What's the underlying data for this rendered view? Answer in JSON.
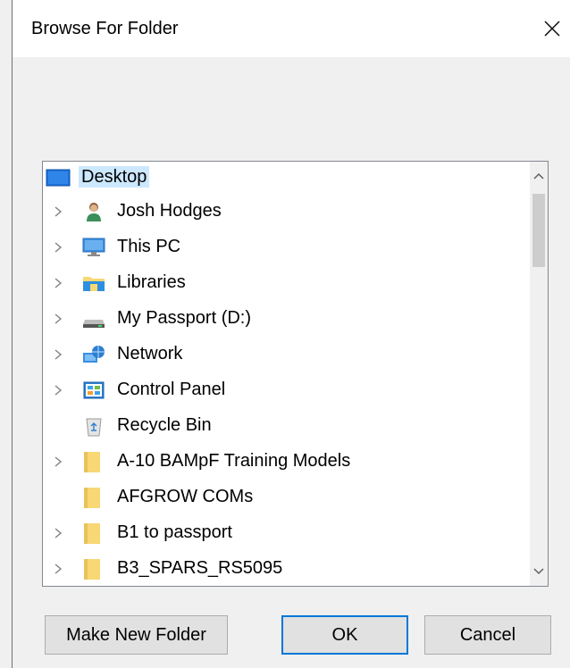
{
  "window": {
    "title": "Browse For Folder",
    "close_icon": "close-icon"
  },
  "tree": {
    "items": [
      {
        "label": "Desktop",
        "icon": "desktop-icon",
        "expandable": false,
        "selected": true,
        "level": 0
      },
      {
        "label": "Josh Hodges",
        "icon": "user-icon",
        "expandable": true,
        "selected": false,
        "level": 1
      },
      {
        "label": "This PC",
        "icon": "computer-icon",
        "expandable": true,
        "selected": false,
        "level": 1
      },
      {
        "label": "Libraries",
        "icon": "libraries-icon",
        "expandable": true,
        "selected": false,
        "level": 1
      },
      {
        "label": "My Passport (D:)",
        "icon": "drive-icon",
        "expandable": true,
        "selected": false,
        "level": 1
      },
      {
        "label": "Network",
        "icon": "network-icon",
        "expandable": true,
        "selected": false,
        "level": 1
      },
      {
        "label": "Control Panel",
        "icon": "control-panel-icon",
        "expandable": true,
        "selected": false,
        "level": 1
      },
      {
        "label": "Recycle Bin",
        "icon": "recycle-bin-icon",
        "expandable": false,
        "selected": false,
        "level": 1
      },
      {
        "label": "A-10 BAMpF Training Models",
        "icon": "folder-icon",
        "expandable": true,
        "selected": false,
        "level": 1
      },
      {
        "label": "AFGROW COMs",
        "icon": "folder-icon",
        "expandable": false,
        "selected": false,
        "level": 1
      },
      {
        "label": "B1 to passport",
        "icon": "folder-icon",
        "expandable": true,
        "selected": false,
        "level": 1
      },
      {
        "label": "B3_SPARS_RS5095",
        "icon": "folder-icon",
        "expandable": true,
        "selected": false,
        "level": 1
      }
    ]
  },
  "buttons": {
    "make_new_folder": "Make New Folder",
    "ok": "OK",
    "cancel": "Cancel"
  },
  "colors": {
    "selection": "#cce8ff",
    "accent": "#0078d7",
    "folder": "#f8d775"
  }
}
